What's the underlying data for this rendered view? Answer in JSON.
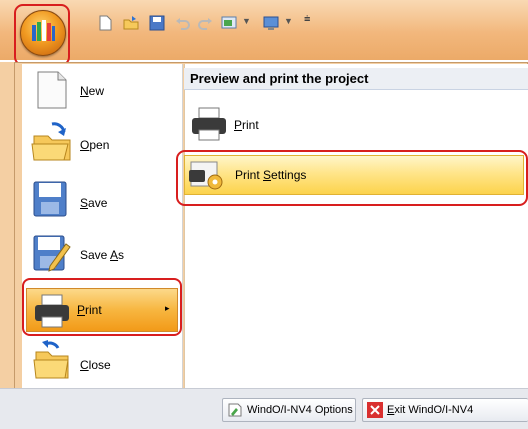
{
  "app_menu": {
    "left_items": [
      {
        "pre": "",
        "accel": "N",
        "post": "ew"
      },
      {
        "pre": "",
        "accel": "O",
        "post": "pen"
      },
      {
        "pre": "",
        "accel": "S",
        "post": "ave"
      },
      {
        "pre": "Save ",
        "accel": "A",
        "post": "s"
      },
      {
        "pre": "",
        "accel": "P",
        "post": "rint"
      },
      {
        "pre": "",
        "accel": "C",
        "post": "lose"
      }
    ],
    "print_panel": {
      "header": "Preview and print the project",
      "items": [
        {
          "pre": "",
          "accel": "P",
          "post": "rint"
        },
        {
          "pre": "Print ",
          "accel": "S",
          "post": "ettings"
        }
      ]
    }
  },
  "footer": {
    "options_label": "WindO/I-NV4 Options",
    "exit_pre": "",
    "exit_accel": "E",
    "exit_post": "xit WindO/I-NV4"
  }
}
